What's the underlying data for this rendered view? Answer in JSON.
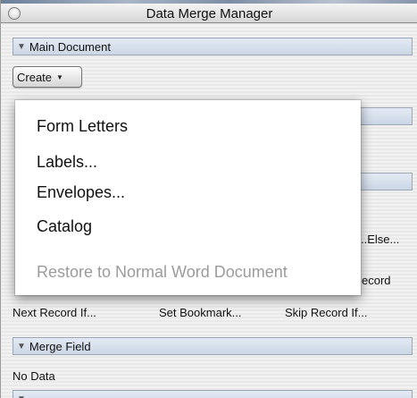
{
  "window": {
    "title": "Data Merge Manager"
  },
  "main_document": {
    "header": "Main Document",
    "create_label": "Create"
  },
  "create_menu": {
    "items": [
      {
        "label": "Form Letters",
        "enabled": true
      },
      {
        "label": "Labels...",
        "enabled": true
      },
      {
        "label": "Envelopes...",
        "enabled": true
      },
      {
        "label": "Catalog",
        "enabled": true
      },
      {
        "label": "Restore to Normal Word Document",
        "enabled": false
      }
    ]
  },
  "partially_hidden": {
    "else_label": "..Else...",
    "record_label": "ecord"
  },
  "merge_buttons": {
    "next_record_if": "Next Record If...",
    "set_bookmark": "Set Bookmark...",
    "skip_record_if": "Skip Record If..."
  },
  "merge_field": {
    "header": "Merge Field",
    "value": "No Data"
  },
  "colors": {
    "section_header_top": "#e3eaf4",
    "section_header_bottom": "#cbd6e5",
    "disabled_text": "#9b9b9b"
  }
}
